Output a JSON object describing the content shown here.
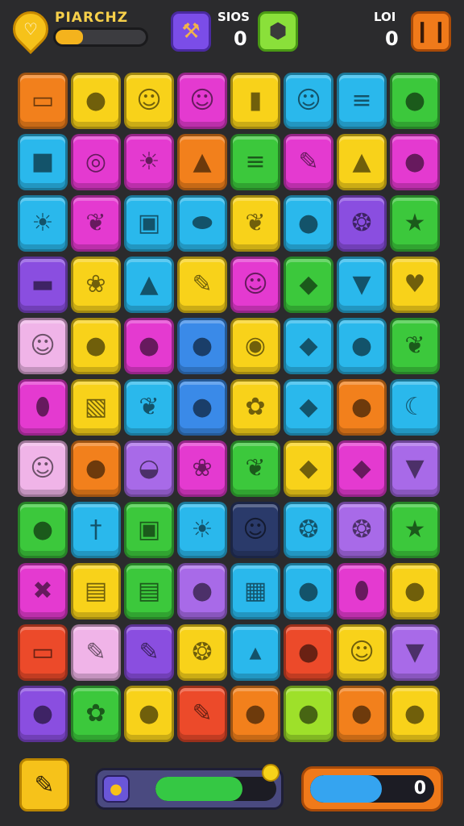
{
  "header": {
    "title": "PIARCHZ",
    "xp_progress": 0.3,
    "heart_icon": "heart-icon",
    "stat1_label": "SIOS",
    "stat1_value": "0",
    "stat2_label": "LOI",
    "stat2_value": "0",
    "hammer_icon": "hammer-icon",
    "gem_icon": "gem-icon",
    "pause_icon": "pause-icon"
  },
  "colors": {
    "background": "#2b2b2d",
    "orange": "#f2801c",
    "yellow": "#f8d21a",
    "magenta": "#e43ad0",
    "green": "#3cc83c",
    "cyan": "#2ab8ec",
    "purple": "#8a4ee0",
    "red": "#ec4a2a",
    "lime": "#9ee02a",
    "navy": "#2a3a6a",
    "pink": "#f0b4e8",
    "violet": "#a86ae8",
    "blue": "#3a8ae8"
  },
  "board": {
    "rows": [
      [
        [
          "orange",
          "scroll"
        ],
        [
          "yellow",
          "apple"
        ],
        [
          "yellow",
          "ghost"
        ],
        [
          "magenta",
          "cat"
        ],
        [
          "yellow",
          "popsicle"
        ],
        [
          "cyan",
          "blob"
        ],
        [
          "cyan",
          "note"
        ],
        [
          "green",
          "orange"
        ]
      ],
      [
        [
          "cyan",
          "square"
        ],
        [
          "magenta",
          "donut"
        ],
        [
          "magenta",
          "sun"
        ],
        [
          "orange",
          "triangle"
        ],
        [
          "green",
          "note"
        ],
        [
          "magenta",
          "pencil"
        ],
        [
          "yellow",
          "triangle"
        ],
        [
          "magenta",
          "apple"
        ]
      ],
      [
        [
          "cyan",
          "sun"
        ],
        [
          "magenta",
          "leaf"
        ],
        [
          "cyan",
          "robot"
        ],
        [
          "cyan",
          "bean"
        ],
        [
          "yellow",
          "leaf"
        ],
        [
          "cyan",
          "apple"
        ],
        [
          "purple",
          "cookie"
        ],
        [
          "green",
          "star"
        ]
      ],
      [
        [
          "purple",
          "eraser"
        ],
        [
          "yellow",
          "berry"
        ],
        [
          "cyan",
          "triangle"
        ],
        [
          "yellow",
          "pencil"
        ],
        [
          "magenta",
          "blob"
        ],
        [
          "green",
          "bell"
        ],
        [
          "cyan",
          "carrot"
        ],
        [
          "yellow",
          "heart"
        ]
      ],
      [
        [
          "pink",
          "cat"
        ],
        [
          "yellow",
          "ball"
        ],
        [
          "magenta",
          "apple"
        ],
        [
          "blue",
          "plum"
        ],
        [
          "yellow",
          "walnut"
        ],
        [
          "cyan",
          "drop"
        ],
        [
          "cyan",
          "lime"
        ],
        [
          "green",
          "leaf"
        ]
      ],
      [
        [
          "magenta",
          "egg"
        ],
        [
          "yellow",
          "cube"
        ],
        [
          "cyan",
          "leaf"
        ],
        [
          "blue",
          "plum"
        ],
        [
          "yellow",
          "flower"
        ],
        [
          "cyan",
          "pepper"
        ],
        [
          "orange",
          "lime"
        ],
        [
          "cyan",
          "banana"
        ]
      ],
      [
        [
          "pink",
          "face"
        ],
        [
          "orange",
          "tomato"
        ],
        [
          "violet",
          "bowl"
        ],
        [
          "magenta",
          "berry"
        ],
        [
          "green",
          "leaf"
        ],
        [
          "yellow",
          "drop"
        ],
        [
          "magenta",
          "bell"
        ],
        [
          "violet",
          "down-triangle"
        ]
      ],
      [
        [
          "green",
          "pot"
        ],
        [
          "cyan",
          "pin"
        ],
        [
          "green",
          "robot"
        ],
        [
          "cyan",
          "sun"
        ],
        [
          "navy",
          "cat"
        ],
        [
          "cyan",
          "cookie"
        ],
        [
          "violet",
          "cookie"
        ],
        [
          "green",
          "star"
        ]
      ],
      [
        [
          "magenta",
          "kite"
        ],
        [
          "yellow",
          "bag"
        ],
        [
          "green",
          "box"
        ],
        [
          "violet",
          "lemon"
        ],
        [
          "cyan",
          "book"
        ],
        [
          "cyan",
          "tomato"
        ],
        [
          "magenta",
          "mango"
        ],
        [
          "yellow",
          "lemon"
        ]
      ],
      [
        [
          "red",
          "scroll"
        ],
        [
          "pink",
          "pencil"
        ],
        [
          "purple",
          "pencil"
        ],
        [
          "yellow",
          "cookie"
        ],
        [
          "cyan",
          "mushroom"
        ],
        [
          "red",
          "ball"
        ],
        [
          "yellow",
          "blob"
        ],
        [
          "violet",
          "carrot"
        ]
      ],
      [
        [
          "purple",
          "tomato"
        ],
        [
          "green",
          "flower"
        ],
        [
          "yellow",
          "ball"
        ],
        [
          "red",
          "pencil"
        ],
        [
          "orange",
          "ball"
        ],
        [
          "lime",
          "ball"
        ],
        [
          "orange",
          "apple"
        ],
        [
          "yellow",
          "plum"
        ]
      ]
    ]
  },
  "footer": {
    "pencil_icon": "pencil-icon",
    "energy_icon": "potion-icon",
    "energy_progress": 0.72,
    "score_progress": 0.58,
    "score_value": "0"
  }
}
